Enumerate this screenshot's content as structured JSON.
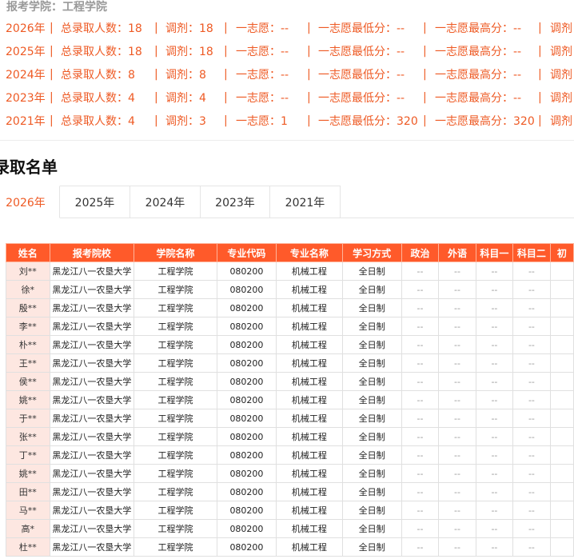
{
  "college": {
    "label": "报考学院：",
    "value": "工程学院"
  },
  "stats": {
    "labels": {
      "total": "总录取人数：",
      "adjust": "调剂：",
      "first_choice": "一志愿：",
      "first_min": "一志愿最低分：",
      "first_max": "一志愿最高分：",
      "adjust_trunc": "调剂"
    },
    "rows": [
      {
        "year": "2026年",
        "total": "18",
        "adjust": "18",
        "first": "--",
        "min": "--",
        "max": "--"
      },
      {
        "year": "2025年",
        "total": "18",
        "adjust": "18",
        "first": "--",
        "min": "--",
        "max": "--"
      },
      {
        "year": "2024年",
        "total": "8",
        "adjust": "8",
        "first": "--",
        "min": "--",
        "max": "--"
      },
      {
        "year": "2023年",
        "total": "4",
        "adjust": "4",
        "first": "--",
        "min": "--",
        "max": "--"
      },
      {
        "year": "2021年",
        "total": "4",
        "adjust": "3",
        "first": "1",
        "min": "320",
        "max": "320"
      }
    ]
  },
  "section_title": "录取名单",
  "tabs": [
    "2026年",
    "2025年",
    "2024年",
    "2023年",
    "2021年"
  ],
  "active_tab": "2026年",
  "table": {
    "headers": [
      "姓名",
      "报考院校",
      "学院名称",
      "专业代码",
      "专业名称",
      "学习方式",
      "政治",
      "外语",
      "科目一",
      "科目二",
      "初"
    ],
    "rows": [
      {
        "name": "刘**",
        "school": "黑龙江八一农垦大学",
        "college": "工程学院",
        "code": "080200",
        "major": "机械工程",
        "mode": "全日制"
      },
      {
        "name": "徐*",
        "school": "黑龙江八一农垦大学",
        "college": "工程学院",
        "code": "080200",
        "major": "机械工程",
        "mode": "全日制"
      },
      {
        "name": "殷**",
        "school": "黑龙江八一农垦大学",
        "college": "工程学院",
        "code": "080200",
        "major": "机械工程",
        "mode": "全日制"
      },
      {
        "name": "李**",
        "school": "黑龙江八一农垦大学",
        "college": "工程学院",
        "code": "080200",
        "major": "机械工程",
        "mode": "全日制"
      },
      {
        "name": "朴**",
        "school": "黑龙江八一农垦大学",
        "college": "工程学院",
        "code": "080200",
        "major": "机械工程",
        "mode": "全日制"
      },
      {
        "name": "王**",
        "school": "黑龙江八一农垦大学",
        "college": "工程学院",
        "code": "080200",
        "major": "机械工程",
        "mode": "全日制"
      },
      {
        "name": "侯**",
        "school": "黑龙江八一农垦大学",
        "college": "工程学院",
        "code": "080200",
        "major": "机械工程",
        "mode": "全日制"
      },
      {
        "name": "姚**",
        "school": "黑龙江八一农垦大学",
        "college": "工程学院",
        "code": "080200",
        "major": "机械工程",
        "mode": "全日制"
      },
      {
        "name": "于**",
        "school": "黑龙江八一农垦大学",
        "college": "工程学院",
        "code": "080200",
        "major": "机械工程",
        "mode": "全日制"
      },
      {
        "name": "张**",
        "school": "黑龙江八一农垦大学",
        "college": "工程学院",
        "code": "080200",
        "major": "机械工程",
        "mode": "全日制"
      },
      {
        "name": "丁**",
        "school": "黑龙江八一农垦大学",
        "college": "工程学院",
        "code": "080200",
        "major": "机械工程",
        "mode": "全日制"
      },
      {
        "name": "姚**",
        "school": "黑龙江八一农垦大学",
        "college": "工程学院",
        "code": "080200",
        "major": "机械工程",
        "mode": "全日制"
      },
      {
        "name": "田**",
        "school": "黑龙江八一农垦大学",
        "college": "工程学院",
        "code": "080200",
        "major": "机械工程",
        "mode": "全日制"
      },
      {
        "name": "马**",
        "school": "黑龙江八一农垦大学",
        "college": "工程学院",
        "code": "080200",
        "major": "机械工程",
        "mode": "全日制"
      },
      {
        "name": "高*",
        "school": "黑龙江八一农垦大学",
        "college": "工程学院",
        "code": "080200",
        "major": "机械工程",
        "mode": "全日制"
      },
      {
        "name": "杜**",
        "school": "黑龙江八一农垦大学",
        "college": "工程学院",
        "code": "080200",
        "major": "机械工程",
        "mode": "全日制"
      }
    ],
    "empty_score": "--"
  }
}
